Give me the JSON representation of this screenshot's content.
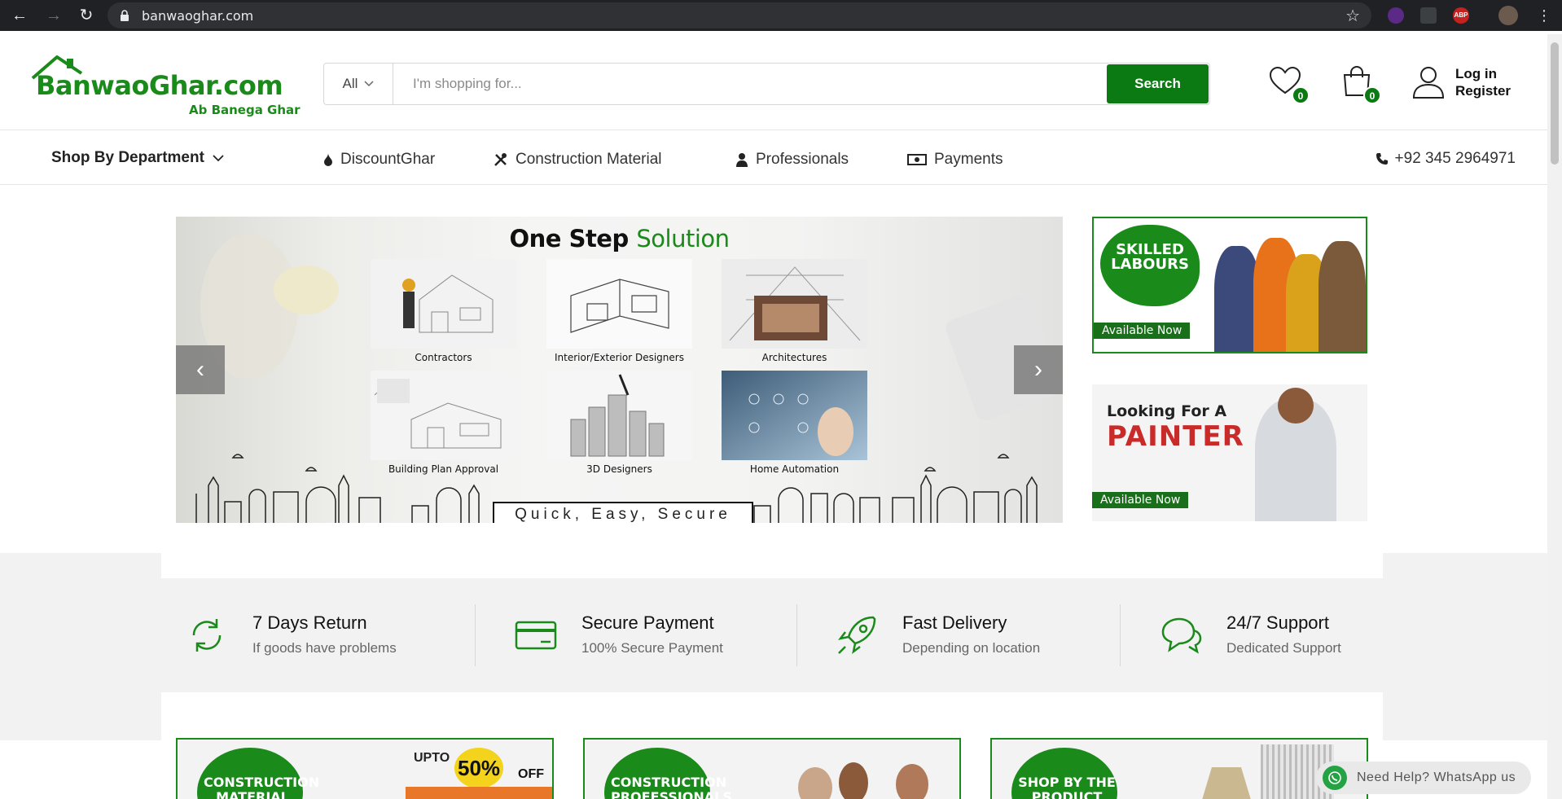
{
  "browser": {
    "url": "banwaoghar.com",
    "extensions": [
      "ext-icon",
      "ext-icon",
      "ABP"
    ]
  },
  "header": {
    "logo_main": "BanwaoGhar.com",
    "logo_tagline": "Ab Banega Ghar",
    "search": {
      "category": "All",
      "placeholder": "I'm shopping for...",
      "button": "Search"
    },
    "wishlist_count": "0",
    "cart_count": "0",
    "login": "Log in",
    "register": "Register"
  },
  "nav": {
    "department": "Shop By Department",
    "items": [
      {
        "label": "DiscountGhar",
        "icon": "flame-icon"
      },
      {
        "label": "Construction Material",
        "icon": "tools-icon"
      },
      {
        "label": "Professionals",
        "icon": "person-icon"
      },
      {
        "label": "Payments",
        "icon": "money-icon"
      }
    ],
    "phone": "+92 345 2964971"
  },
  "hero": {
    "title_bold": "One Step",
    "title_green": "Solution",
    "tiles": [
      {
        "caption": "Contractors"
      },
      {
        "caption": "Interior/Exterior Designers"
      },
      {
        "caption": "Architectures"
      },
      {
        "caption": "Building Plan Approval"
      },
      {
        "caption": "3D Designers"
      },
      {
        "caption": "Home Automation"
      }
    ],
    "tagline": "Quick, Easy, Secure"
  },
  "side_banners": {
    "skilled": {
      "title": "SKILLED LABOURS",
      "badge": "Available Now"
    },
    "painter": {
      "line1": "Looking For A",
      "line2": "PAINTER",
      "badge": "Available Now"
    }
  },
  "features": [
    {
      "title": "7 Days Return",
      "subtitle": "If goods have problems",
      "icon": "refresh-icon"
    },
    {
      "title": "Secure Payment",
      "subtitle": "100% Secure Payment",
      "icon": "credit-card-icon"
    },
    {
      "title": "Fast Delivery",
      "subtitle": "Depending on location",
      "icon": "rocket-icon"
    },
    {
      "title": "24/7 Support",
      "subtitle": "Dedicated Support",
      "icon": "chat-icon"
    }
  ],
  "cards": [
    {
      "title": "CONSTRUCTION MATERIAL",
      "promo_prefix": "UPTO",
      "promo_value": "50%",
      "promo_suffix": "OFF"
    },
    {
      "title": "CONSTRUCTION PROFESSIONALS"
    },
    {
      "title": "SHOP BY THE PRODUCT"
    }
  ],
  "whatsapp": "Need Help? WhatsApp us",
  "colors": {
    "brand_green": "#1a8a1a",
    "button_green": "#0c7a12"
  }
}
